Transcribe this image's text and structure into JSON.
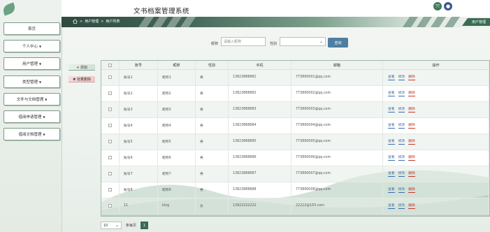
{
  "header": {
    "title": "文书档案管理系统",
    "icons": [
      "switch-icon",
      "user-icon"
    ],
    "accent": "#3b6b55"
  },
  "breadcrumb": [
    "用户管理",
    "用户列表"
  ],
  "page_tag": "用户管理",
  "sidebar": {
    "items": [
      {
        "label": "首页",
        "caret": false
      },
      {
        "label": "个人中心",
        "caret": true
      },
      {
        "label": "用户管理",
        "caret": true
      },
      {
        "label": "类型管理",
        "caret": true
      },
      {
        "label": "文件与文档管理",
        "caret": true
      },
      {
        "label": "借阅申请管理",
        "caret": true
      },
      {
        "label": "借阅文档管理",
        "caret": true
      }
    ]
  },
  "search": {
    "nickname_label": "昵称",
    "nickname_placeholder": "请输入昵称",
    "gender_label": "性别",
    "gender_value": "",
    "button": "查询"
  },
  "actions": {
    "add": "+ 添加",
    "batch_delete": "✖ 批量删除"
  },
  "table": {
    "columns": [
      "账号",
      "昵称",
      "性别",
      "手机",
      "邮箱",
      "操作"
    ],
    "row_actions": {
      "view": "查看",
      "edit": "修改",
      "delete": "删除"
    },
    "rows": [
      {
        "account": "账号1",
        "nickname": "昵称1",
        "gender": "男",
        "phone": "13823888881",
        "email": "773890001@qq.com"
      },
      {
        "account": "账号2",
        "nickname": "昵称2",
        "gender": "男",
        "phone": "13823888882",
        "email": "773890002@qq.com"
      },
      {
        "account": "账号3",
        "nickname": "昵称3",
        "gender": "男",
        "phone": "13823888883",
        "email": "773890003@qq.com"
      },
      {
        "account": "账号4",
        "nickname": "昵称4",
        "gender": "男",
        "phone": "13823888884",
        "email": "773890004@qq.com"
      },
      {
        "account": "账号5",
        "nickname": "昵称5",
        "gender": "男",
        "phone": "13823888885",
        "email": "773890005@qq.com"
      },
      {
        "account": "账号6",
        "nickname": "昵称6",
        "gender": "男",
        "phone": "13823888886",
        "email": "773890006@qq.com"
      },
      {
        "account": "账号7",
        "nickname": "昵称7",
        "gender": "男",
        "phone": "13823888887",
        "email": "773890007@qq.com"
      },
      {
        "account": "账号8",
        "nickname": "昵称8",
        "gender": "男",
        "phone": "13823888888",
        "email": "773890008@qq.com"
      },
      {
        "account": "11",
        "nickname": "king",
        "gender": "女",
        "phone": "13922222222",
        "email": "22222@163.com"
      }
    ]
  },
  "pager": {
    "page_size": "10",
    "page_size_suffix": "条每页",
    "current_page": "1"
  }
}
